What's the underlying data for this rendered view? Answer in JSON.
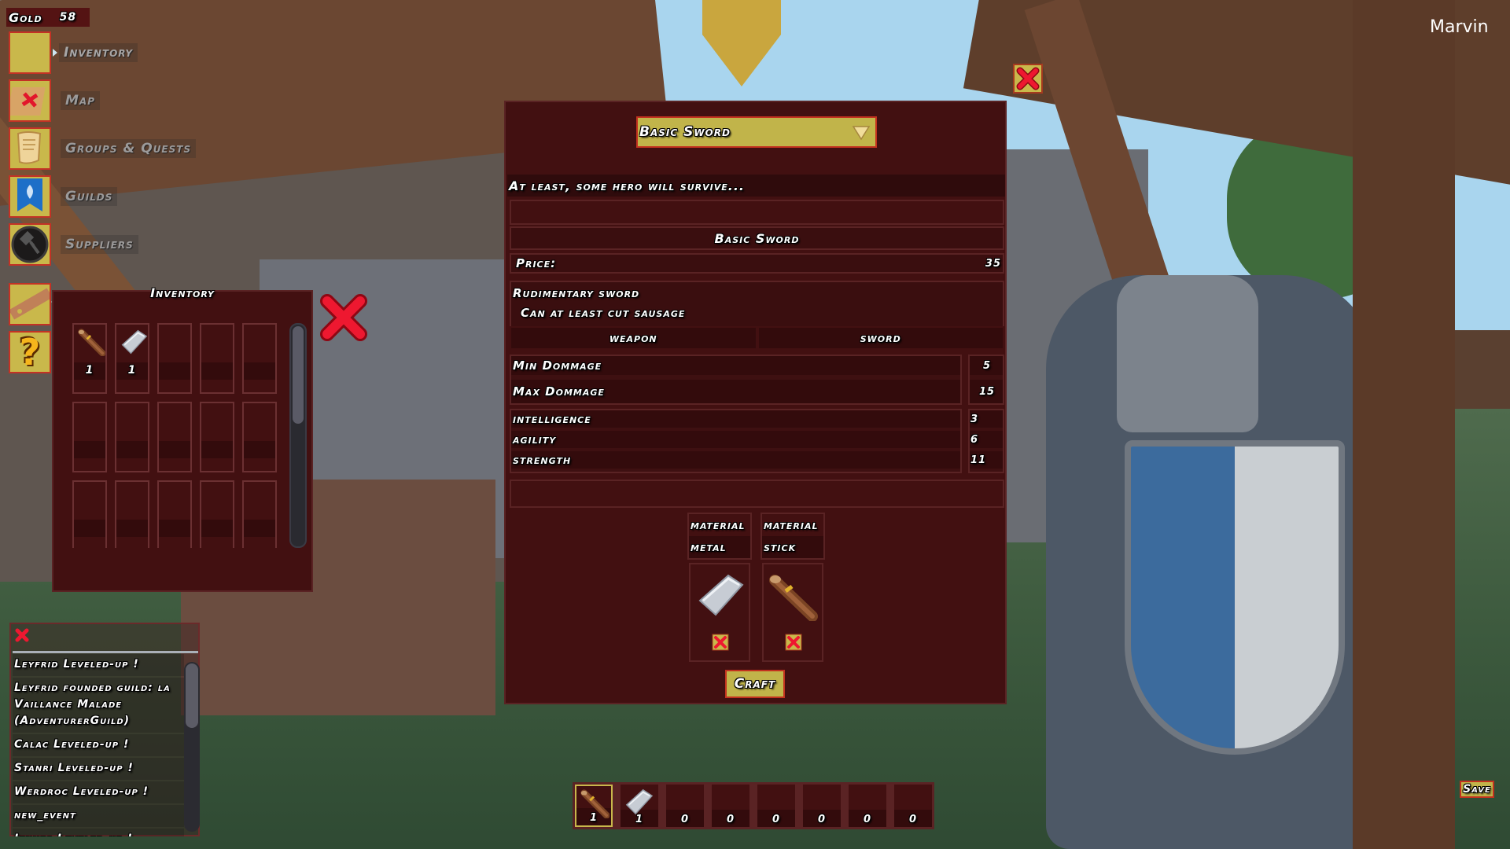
{
  "hud": {
    "gold_label": "Gold",
    "gold_value": "58",
    "player_name": "Marvin",
    "save_label": "Save"
  },
  "side_menu": {
    "items": [
      {
        "label": "Inventory",
        "icon": "inventory-icon",
        "active": true
      },
      {
        "label": "Map",
        "icon": "map-icon"
      },
      {
        "label": "Groups & Quests",
        "icon": "scroll-icon"
      },
      {
        "label": "Guilds",
        "icon": "guild-banner-icon"
      },
      {
        "label": "Suppliers",
        "icon": "hammer-icon"
      },
      {
        "label": "",
        "icon": "ruler-icon"
      },
      {
        "label": "",
        "icon": "help-icon"
      }
    ]
  },
  "inventory": {
    "title": "Inventory",
    "slots": [
      {
        "item": "stick",
        "count": "1"
      },
      {
        "item": "metal",
        "count": "1"
      },
      {
        "item": "",
        "count": ""
      },
      {
        "item": "",
        "count": ""
      },
      {
        "item": "",
        "count": ""
      },
      {
        "item": "",
        "count": ""
      },
      {
        "item": "",
        "count": ""
      },
      {
        "item": "",
        "count": ""
      },
      {
        "item": "",
        "count": ""
      },
      {
        "item": "",
        "count": ""
      },
      {
        "item": "",
        "count": ""
      },
      {
        "item": "",
        "count": ""
      },
      {
        "item": "",
        "count": ""
      },
      {
        "item": "",
        "count": ""
      },
      {
        "item": "",
        "count": ""
      }
    ]
  },
  "event_log": {
    "entries": [
      "Leyfrid Leveled-up !",
      "Leyfrid founded guild: la Vaillance Malade (AdventurerGuild)",
      "Calac Leveled-up !",
      "Stanri Leveled-up !",
      "Werdroc Leveled-up !",
      "new_event",
      "Jenhes Leveled-up !"
    ]
  },
  "crafting": {
    "selected_recipe": "Basic Sword",
    "flavor_text": "At least, some hero will survive...",
    "item_name": "Basic Sword",
    "price_label": "Price:",
    "price_value": "35",
    "description_line1": "Rudimentary sword",
    "description_line2": "Can at least cut sausage",
    "type": "weapon",
    "subtype": "sword",
    "damage": [
      {
        "label": "Min Dommage",
        "value": "5"
      },
      {
        "label": "Max Dommage",
        "value": "15"
      }
    ],
    "attributes": [
      {
        "label": "intelligence",
        "value": "3"
      },
      {
        "label": "agility",
        "value": "6"
      },
      {
        "label": "strength",
        "value": "11"
      }
    ],
    "materials": [
      {
        "header": "material",
        "kind": "metal",
        "item": "metal"
      },
      {
        "header": "material",
        "kind": "stick",
        "item": "stick"
      }
    ],
    "craft_label": "Craft"
  },
  "hotbar": {
    "slots": [
      {
        "item": "stick",
        "count": "1",
        "selected": true
      },
      {
        "item": "metal",
        "count": "1"
      },
      {
        "item": "",
        "count": "0"
      },
      {
        "item": "",
        "count": "0"
      },
      {
        "item": "",
        "count": "0"
      },
      {
        "item": "",
        "count": "0"
      },
      {
        "item": "",
        "count": "0"
      },
      {
        "item": "",
        "count": "0"
      }
    ]
  },
  "colors": {
    "panel_bg": "#421011",
    "panel_border": "#5a2324",
    "button_yellow": "#c1b44a",
    "button_border": "#c3321f",
    "close_red": "#e0142a"
  }
}
